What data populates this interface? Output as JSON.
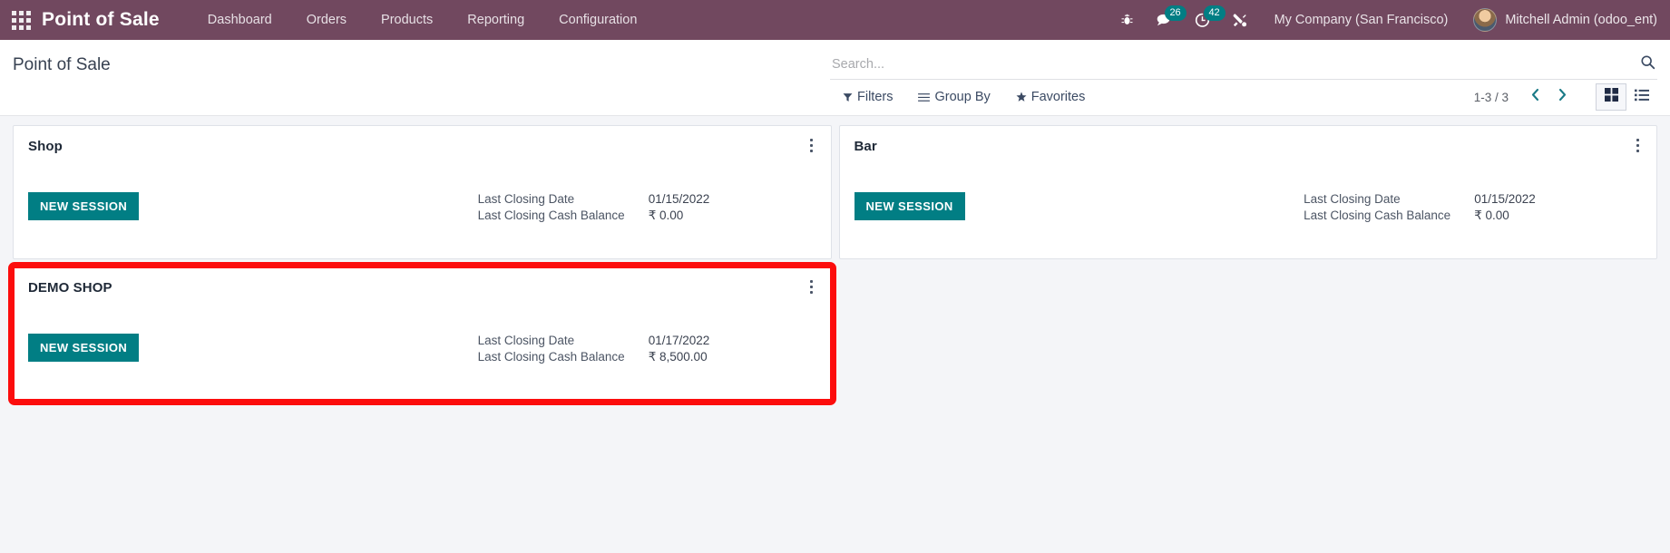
{
  "navbar": {
    "apps_icon": "apps-grid-icon",
    "brand": "Point of Sale",
    "menu": [
      {
        "label": "Dashboard"
      },
      {
        "label": "Orders"
      },
      {
        "label": "Products"
      },
      {
        "label": "Reporting"
      },
      {
        "label": "Configuration"
      }
    ],
    "sys_icons": [
      {
        "name": "bug-icon",
        "badge": null
      },
      {
        "name": "messages-icon",
        "badge": "26"
      },
      {
        "name": "activities-clock-icon",
        "badge": "42"
      },
      {
        "name": "tools-wrench-icon",
        "badge": null
      }
    ],
    "company": "My Company (San Francisco)",
    "user": "Mitchell Admin (odoo_ent)",
    "colors": {
      "bar": "#71485f",
      "badge": "#017e84"
    }
  },
  "control_panel": {
    "title": "Point of Sale",
    "search": {
      "placeholder": "Search...",
      "value": ""
    },
    "search_icon": "magnifier-icon",
    "filters": [
      {
        "label": "Filters",
        "icon": "funnel-icon"
      },
      {
        "label": "Group By",
        "icon": "list-lines-icon"
      },
      {
        "label": "Favorites",
        "icon": "star-icon"
      }
    ],
    "pager": {
      "count": "1-3 / 3",
      "prev_icon": "chevron-left-icon",
      "next_icon": "chevron-right-icon"
    },
    "views": [
      {
        "name": "kanban-view-icon",
        "active": true
      },
      {
        "name": "list-view-icon",
        "active": false
      }
    ]
  },
  "kanban": {
    "labels": {
      "last_closing_date": "Last Closing Date",
      "last_closing_cash_balance": "Last Closing Cash Balance",
      "new_session": "NEW SESSION"
    },
    "cards": [
      {
        "title": "Shop",
        "new_session": "NEW SESSION",
        "last_closing_date_label": "Last Closing Date",
        "last_closing_date_value": "01/15/2022",
        "last_closing_balance_label": "Last Closing Cash Balance",
        "last_closing_balance_value": "₹ 0.00",
        "highlighted": false
      },
      {
        "title": "Bar",
        "new_session": "NEW SESSION",
        "last_closing_date_label": "Last Closing Date",
        "last_closing_date_value": "01/15/2022",
        "last_closing_balance_label": "Last Closing Cash Balance",
        "last_closing_balance_value": "₹ 0.00",
        "highlighted": false
      },
      {
        "title": "DEMO SHOP",
        "new_session": "NEW SESSION",
        "last_closing_date_label": "Last Closing Date",
        "last_closing_date_value": "01/17/2022",
        "last_closing_balance_label": "Last Closing Cash Balance",
        "last_closing_balance_value": "₹ 8,500.00",
        "highlighted": true,
        "highlight_color": "#fc0d0d"
      }
    ]
  }
}
